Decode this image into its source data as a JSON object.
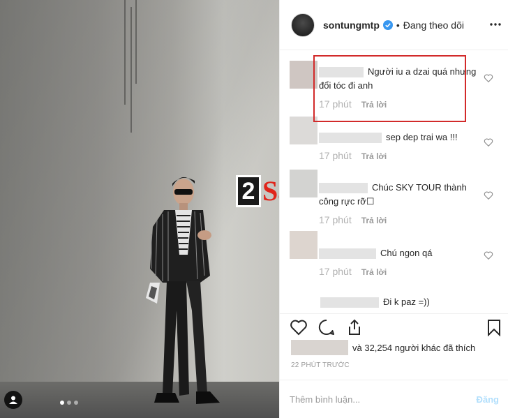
{
  "watermark": {
    "number": "2",
    "text": "Sao"
  },
  "header": {
    "username": "sontungmtp",
    "separator": "•",
    "follow_state": "Đang theo dõi"
  },
  "comments": [
    {
      "text": "Người iu a dzai quá nhưng đổi tóc đi anh",
      "time": "17 phút",
      "reply": "Trả lời"
    },
    {
      "text": "sep dep trai wa !!!",
      "time": "17 phút",
      "reply": "Trả lời"
    },
    {
      "text": "Chúc SKY TOUR thành công rực rỡ☐",
      "time": "17 phút",
      "reply": "Trả lời"
    },
    {
      "text": "Chú ngon qá",
      "time": "17 phút",
      "reply": "Trả lời"
    },
    {
      "text": "Đi k paz =))",
      "time": "",
      "reply": ""
    }
  ],
  "likes": {
    "text": "và 32,254 người khác đã thích"
  },
  "timestamp": "22 PHÚT TRƯỚC",
  "add_comment": {
    "placeholder": "Thêm bình luận...",
    "post_label": "Đăng"
  },
  "colors": {
    "highlight": "#d22a2a",
    "post_button": "#b2dffc",
    "verified": "#3897f0"
  },
  "icons": [
    "user-tag-icon",
    "verified-icon",
    "more-icon",
    "heart-icon",
    "comment-icon",
    "share-icon",
    "bookmark-icon"
  ]
}
